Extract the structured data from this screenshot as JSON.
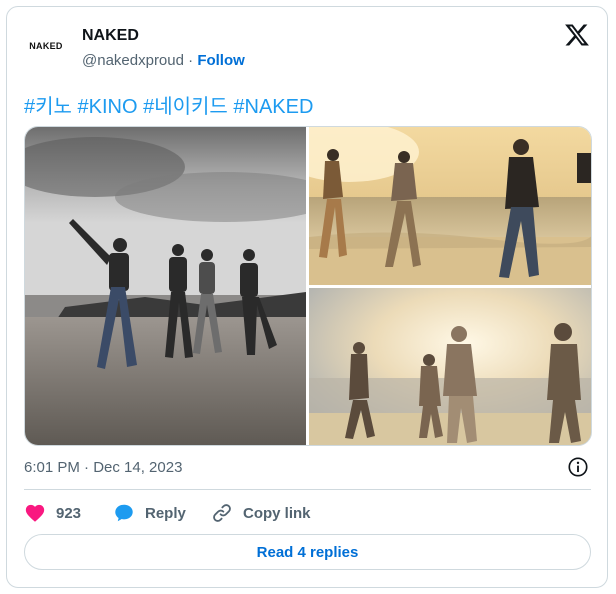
{
  "author": {
    "avatar_text": "NAKED",
    "name": "NAKED",
    "handle": "@nakedxproud",
    "separator": "·",
    "follow_label": "Follow"
  },
  "tweet": {
    "hashtags": [
      "#키노",
      "#KINO",
      "#네이키드",
      "#NAKED"
    ]
  },
  "media": {
    "photos": [
      {
        "alt": "group-on-beach-photo"
      },
      {
        "alt": "running-on-beach-photo"
      },
      {
        "alt": "sunset-silhouettes-photo"
      }
    ]
  },
  "meta": {
    "timestamp": "6:01 PM · Dec 14, 2023"
  },
  "actions": {
    "like_count": "923",
    "reply_label": "Reply",
    "copy_label": "Copy link"
  },
  "footer": {
    "read_replies_label": "Read 4 replies"
  },
  "colors": {
    "like": "#f91880",
    "reply": "#1d9bf0",
    "link": "#006fd6",
    "hashtag": "#1d9bf0"
  },
  "icons": [
    "x-logo-icon",
    "info-icon",
    "heart-icon",
    "speech-bubble-icon",
    "link-icon"
  ]
}
